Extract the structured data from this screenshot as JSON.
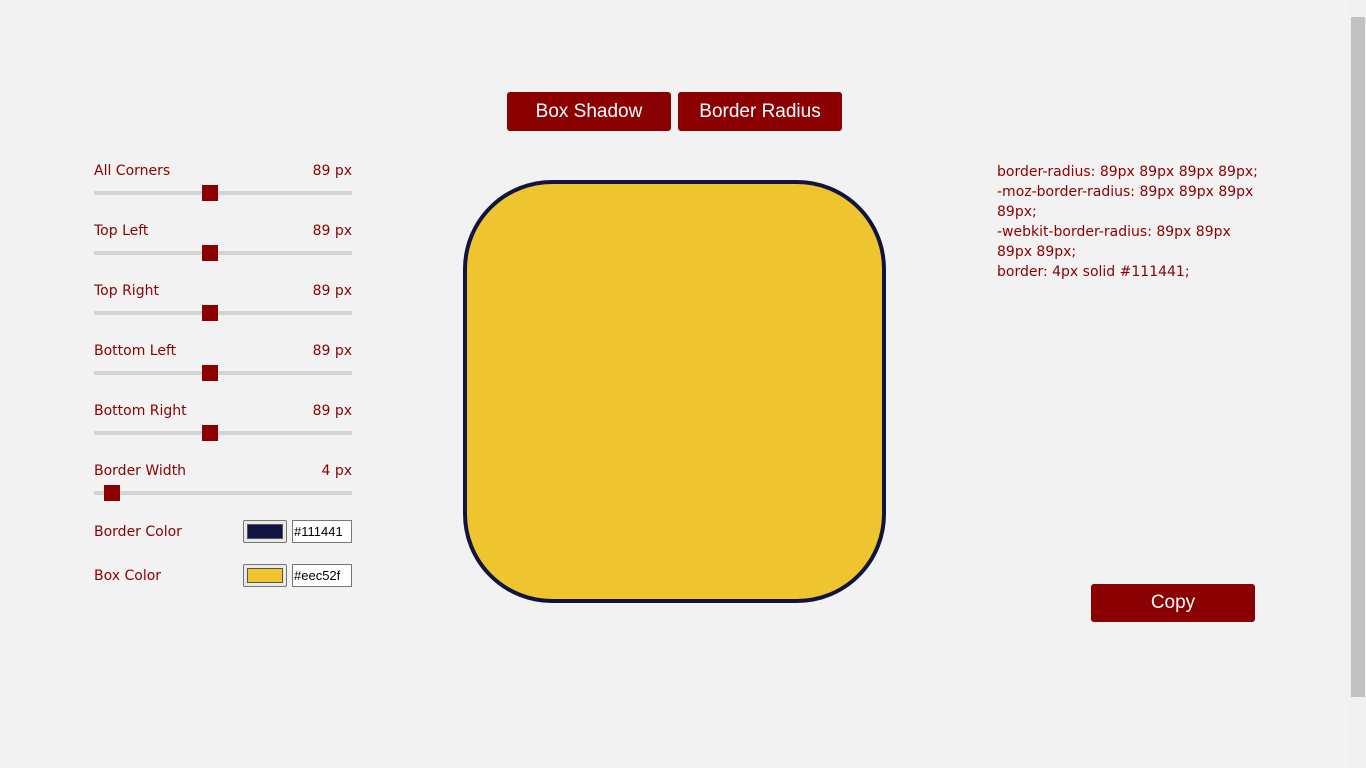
{
  "tabs": {
    "box_shadow": "Box Shadow",
    "border_radius": "Border Radius"
  },
  "controls": [
    {
      "label": "All Corners",
      "value": 89,
      "unit": "89 px",
      "max": 200
    },
    {
      "label": "Top Left",
      "value": 89,
      "unit": "89 px",
      "max": 200
    },
    {
      "label": "Top Right",
      "value": 89,
      "unit": "89 px",
      "max": 200
    },
    {
      "label": "Bottom Left",
      "value": 89,
      "unit": "89 px",
      "max": 200
    },
    {
      "label": "Bottom Right",
      "value": 89,
      "unit": "89 px",
      "max": 200
    },
    {
      "label": "Border Width",
      "value": 4,
      "unit": "4 px",
      "max": 100
    }
  ],
  "border_color": {
    "label": "Border Color",
    "value": "#111441"
  },
  "box_color": {
    "label": "Box Color",
    "value": "#eec52f"
  },
  "code": [
    "border-radius: 89px 89px 89px 89px;",
    "-moz-border-radius: 89px 89px 89px 89px;",
    "-webkit-border-radius: 89px 89px 89px 89px;",
    "border: 4px solid #111441;"
  ],
  "copy_label": "Copy",
  "colors": {
    "accent": "#8b0000",
    "background": "#f2f2f2"
  }
}
